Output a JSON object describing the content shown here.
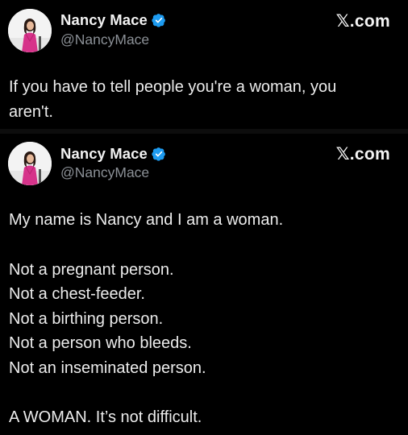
{
  "posts": [
    {
      "author": {
        "name": "Nancy Mace",
        "handle": "@NancyMace",
        "verified": true,
        "avatar_icon": "profile-photo-woman-pink-dress"
      },
      "brand": "𝕏.com",
      "text_lines": [
        "If you have to tell people you're a woman, you",
        "aren't."
      ]
    },
    {
      "author": {
        "name": "Nancy Mace",
        "handle": "@NancyMace",
        "verified": true,
        "avatar_icon": "profile-photo-woman-pink-dress"
      },
      "brand": "𝕏.com",
      "text_lines": [
        "My name is Nancy and I am a woman.",
        "",
        "Not a pregnant person.",
        "Not a chest-feeder.",
        "Not a birthing person.",
        "Not a person who bleeds.",
        "Not an inseminated person.",
        "",
        "A WOMAN.  It’s not difficult."
      ]
    }
  ],
  "colors": {
    "background": "#000000",
    "text": "#ececec",
    "handle": "#8b9096",
    "verified_badge": "#1d9bf0",
    "avatar_dress": "#d6338a"
  }
}
